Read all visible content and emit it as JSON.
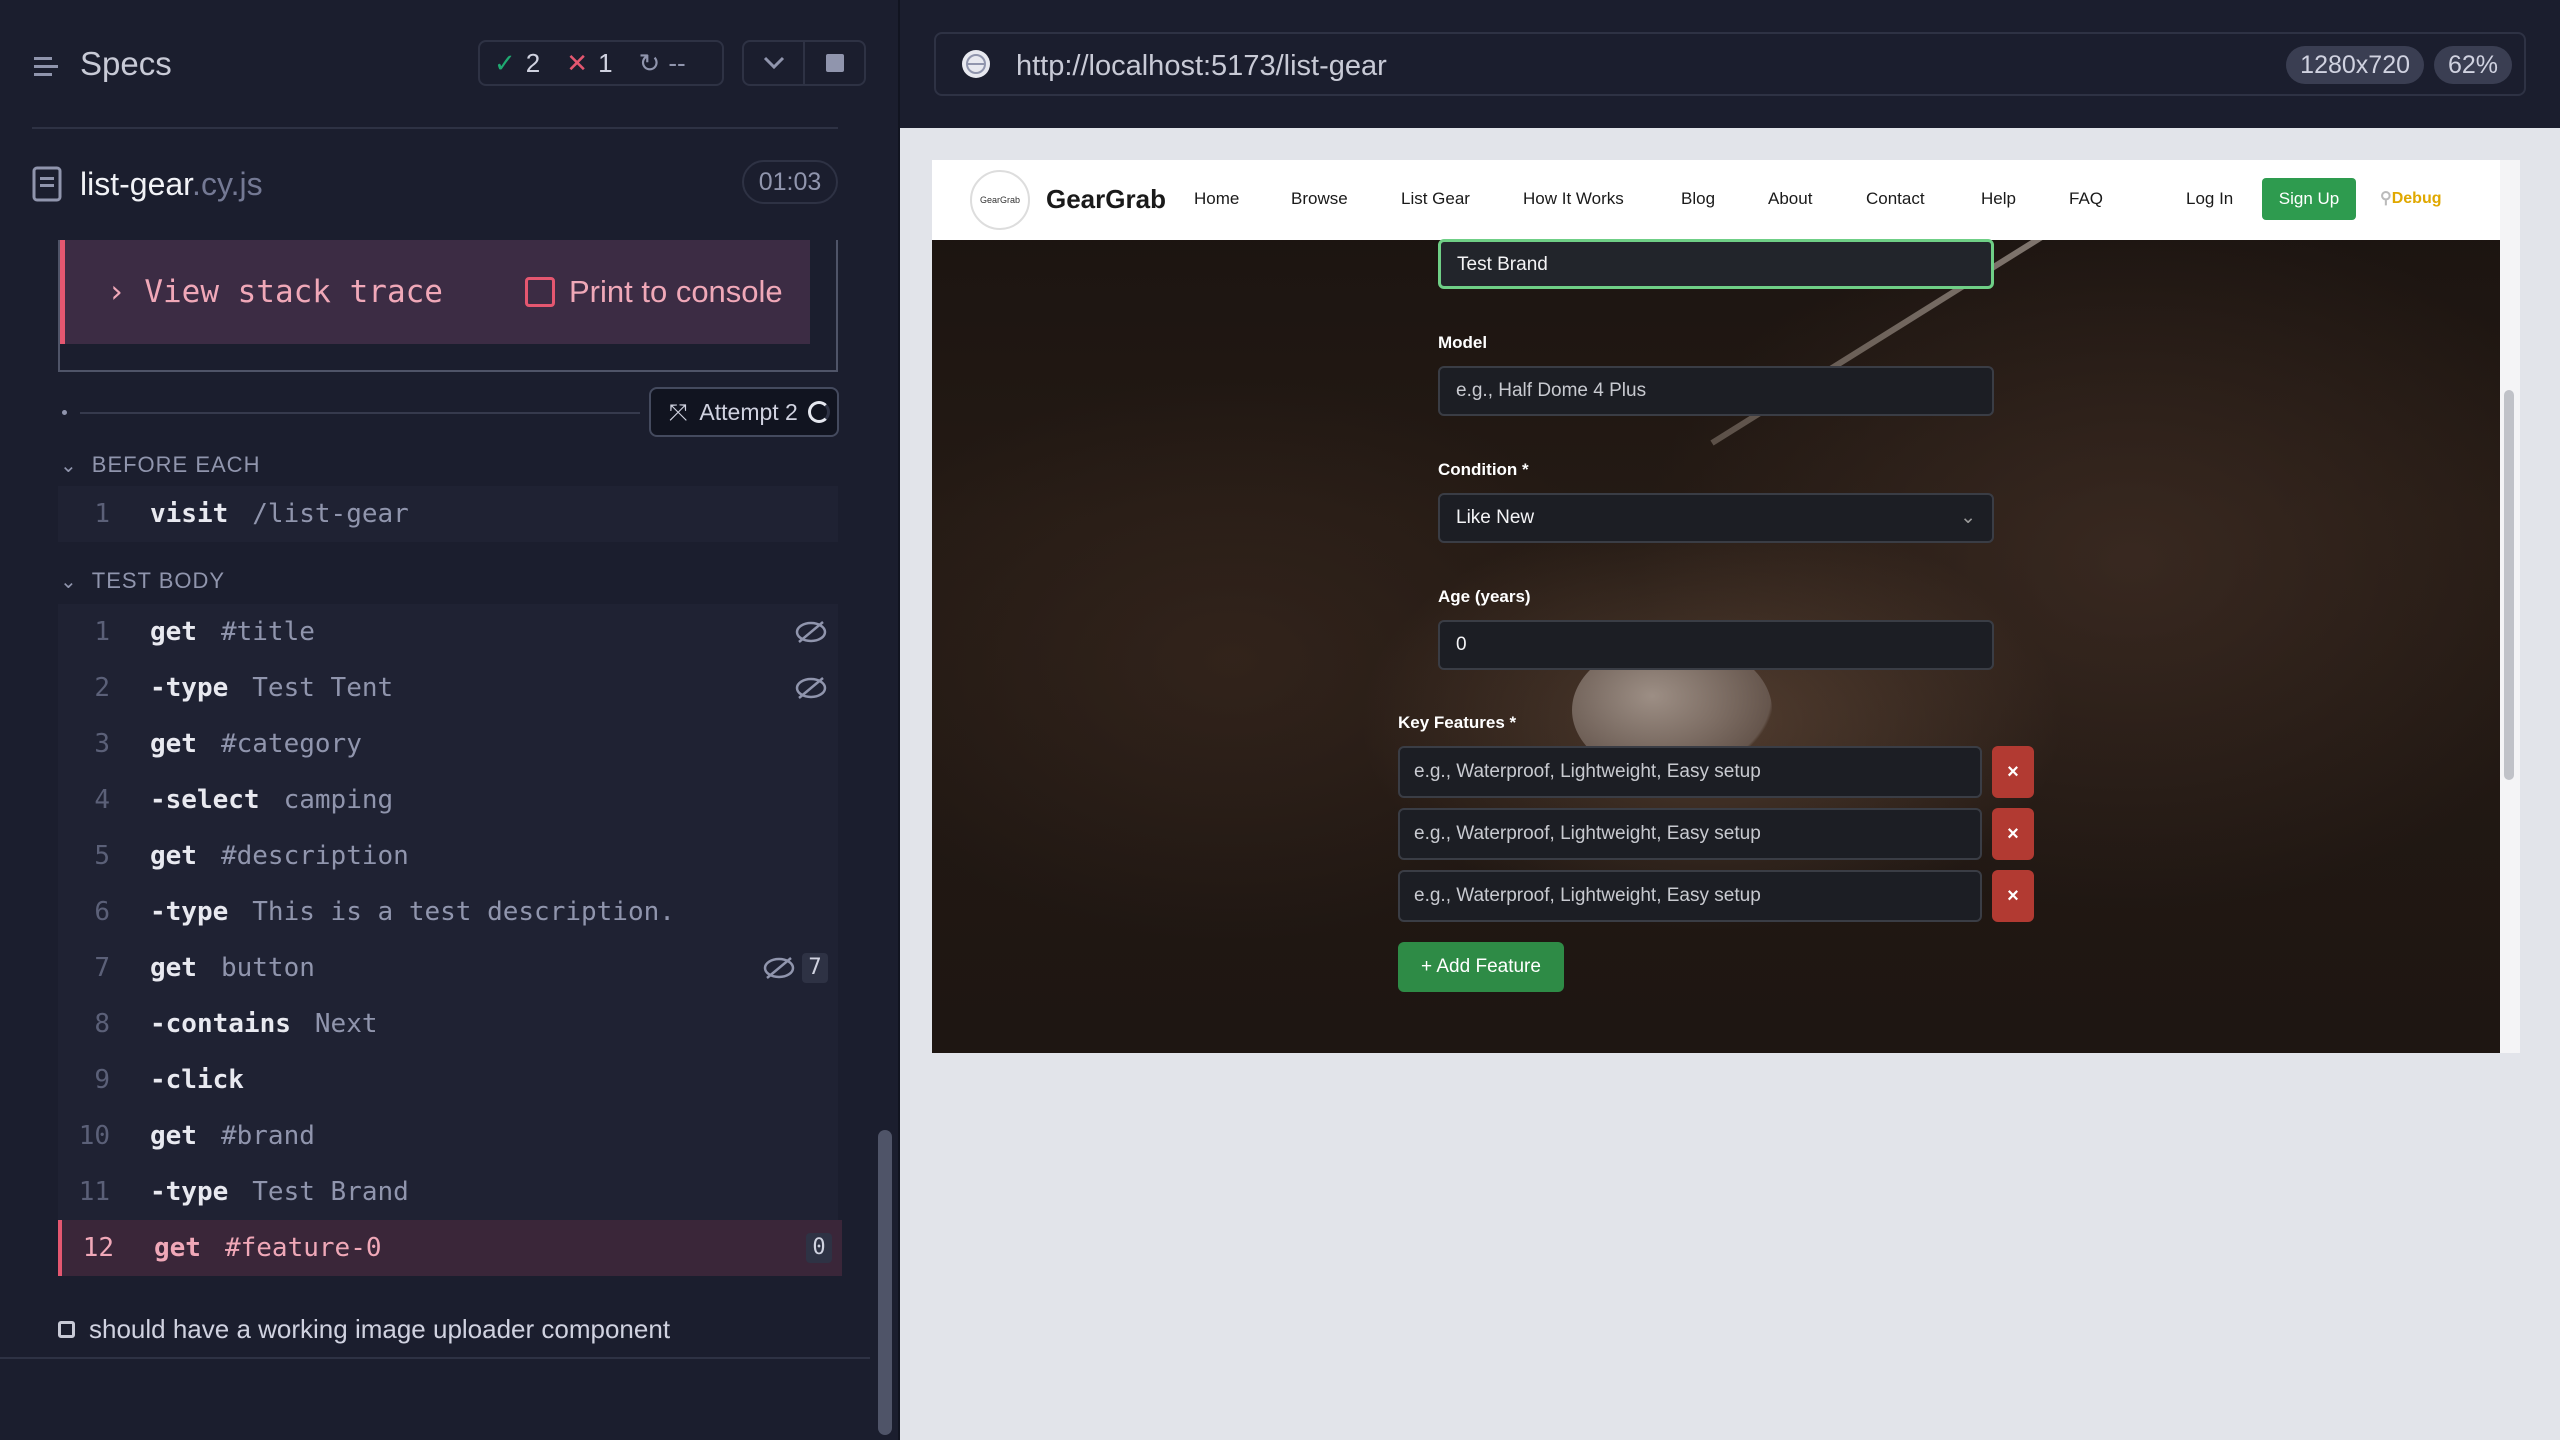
{
  "reporter": {
    "title": "Specs",
    "stats": {
      "passed": "2",
      "failed": "1",
      "pending": "--"
    },
    "spec_file": {
      "name": "list-gear",
      "ext": ".cy.js"
    },
    "duration": "01:03",
    "error_actions": {
      "stack_trace": "View stack trace",
      "print_console": "Print to console"
    },
    "attempt_label": "Attempt 2",
    "before_each_label": "BEFORE EACH",
    "test_body_label": "TEST BODY",
    "before_each": [
      {
        "num": "1",
        "name": "visit",
        "msg": "/list-gear"
      }
    ],
    "commands": [
      {
        "num": "1",
        "name": "get",
        "msg": "#title"
      },
      {
        "num": "2",
        "name": "-type",
        "msg": "Test Tent"
      },
      {
        "num": "3",
        "name": "get",
        "msg": "#category"
      },
      {
        "num": "4",
        "name": "-select",
        "msg": "camping"
      },
      {
        "num": "5",
        "name": "get",
        "msg": "#description"
      },
      {
        "num": "6",
        "name": "-type",
        "msg": "This is a test description."
      },
      {
        "num": "7",
        "name": "get",
        "msg": "button",
        "badge": "7"
      },
      {
        "num": "8",
        "name": "-contains",
        "msg": "Next"
      },
      {
        "num": "9",
        "name": "-click",
        "msg": ""
      },
      {
        "num": "10",
        "name": "get",
        "msg": "#brand"
      },
      {
        "num": "11",
        "name": "-type",
        "msg": "Test Brand"
      },
      {
        "num": "12",
        "name": "get",
        "msg": "#feature-0",
        "badge": "0"
      }
    ],
    "next_test": "should have a working image uploader component"
  },
  "browser": {
    "url": "http://localhost:5173/list-gear",
    "viewport": "1280x720",
    "zoom": "62%"
  },
  "app": {
    "brand": "GearGrab",
    "logo_text": "GearGrab",
    "nav": [
      "Home",
      "Browse",
      "List Gear",
      "How It Works",
      "Blog",
      "About",
      "Contact",
      "Help",
      "FAQ"
    ],
    "login": "Log In",
    "signup": "Sign Up",
    "debug": "Debug",
    "brand_value": "Test Brand",
    "model_label": "Model",
    "model_placeholder": "e.g., Half Dome 4 Plus",
    "condition_label": "Condition *",
    "condition_value": "Like New",
    "age_label": "Age (years)",
    "age_value": "0",
    "features_label": "Key Features *",
    "feature_placeholder": "e.g., Waterproof, Lightweight, Easy setup",
    "remove_glyph": "×",
    "add_feature": "+ Add Feature"
  }
}
